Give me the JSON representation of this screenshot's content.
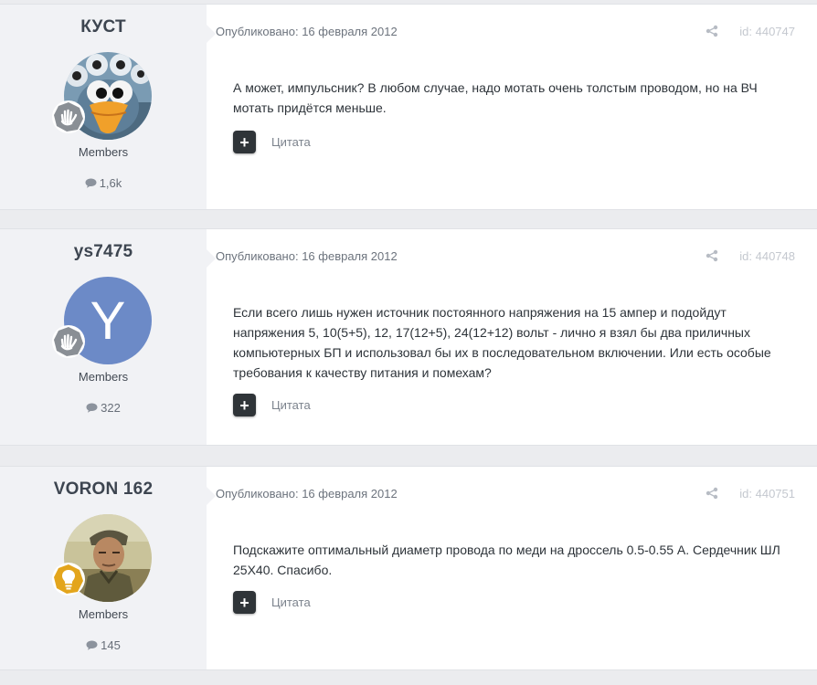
{
  "posts": [
    {
      "author": "КУСТ",
      "group": "Members",
      "post_count": "1,6k",
      "published": "Опубликовано: 16 февраля 2012",
      "id_label": "id: 440747",
      "body": "А может, импульсник? В любом случае, надо мотать очень толстым проводом, но на ВЧ мотать придётся меньше.",
      "quote_label": "Цитата",
      "plus_label": "+"
    },
    {
      "author": "ys7475",
      "avatar_letter": "Y",
      "group": "Members",
      "post_count": "322",
      "published": "Опубликовано: 16 февраля 2012",
      "id_label": "id: 440748",
      "body": "Если всего лишь нужен источник постоянного напряжения на 15 ампер и подойдут напряжения 5, 10(5+5), 12, 17(12+5), 24(12+12) вольт - лично я взял бы два приличных компьютерных БП и использовал бы их в последовательном включении. Или есть особые требования к качеству питания и помехам?",
      "quote_label": "Цитата",
      "plus_label": "+"
    },
    {
      "author": "VORON 162",
      "group": "Members",
      "post_count": "145",
      "published": "Опубликовано: 16 февраля 2012",
      "id_label": "id: 440751",
      "body": "Подскажите оптимальный диаметр провода по меди на дроссель 0.5-0.55 А. Сердечник ШЛ 25Х40. Спасибо.",
      "quote_label": "Цитата",
      "plus_label": "+"
    }
  ],
  "icons": {
    "rank_badge": "waving-hand-icon",
    "rank_badge_3": "lightbulb-icon",
    "share": "share-icon",
    "comment": "comment-bubble-icon"
  },
  "colors": {
    "page_bg": "#ebecef",
    "sidebar_bg": "#f1f2f5",
    "letter_avatar": "#6c8ac7",
    "badge_gray": "#8a8f95",
    "badge_gold": "#e3a51c"
  }
}
